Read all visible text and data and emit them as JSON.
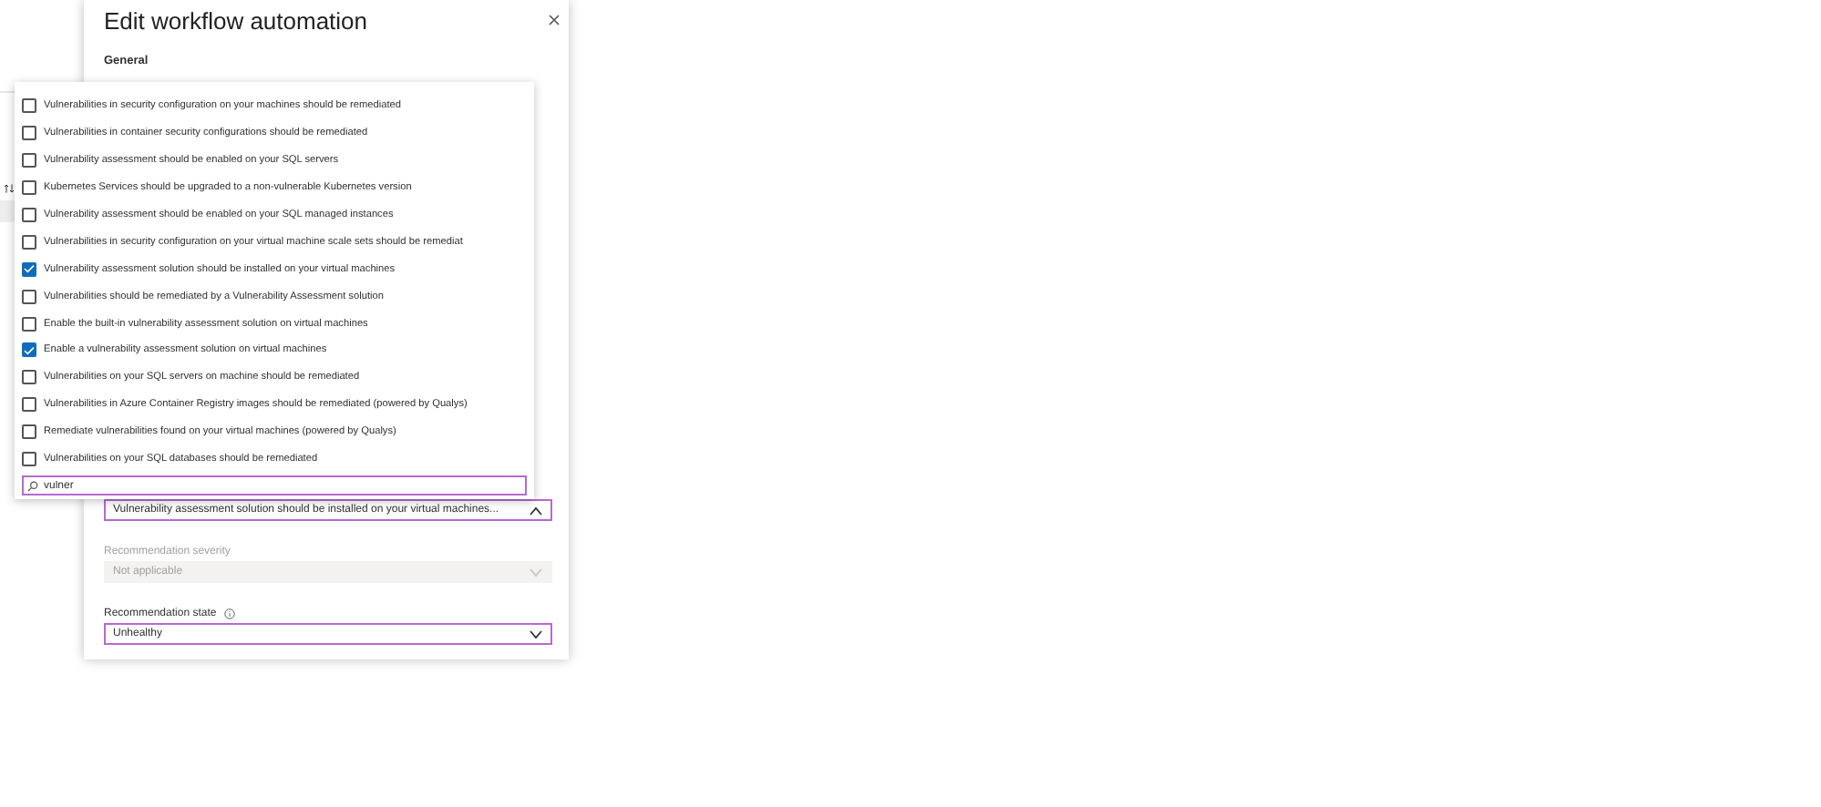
{
  "panel": {
    "title": "Edit workflow automation",
    "section": "General"
  },
  "recommendation_dropdown": {
    "options": [
      {
        "label": "Vulnerabilities in security configuration on your machines should be remediated",
        "checked": false
      },
      {
        "label": "Vulnerabilities in container security configurations should be remediated",
        "checked": false
      },
      {
        "label": "Vulnerability assessment should be enabled on your SQL servers",
        "checked": false
      },
      {
        "label": "Kubernetes Services should be upgraded to a non-vulnerable Kubernetes version",
        "checked": false
      },
      {
        "label": "Vulnerability assessment should be enabled on your SQL managed instances",
        "checked": false
      },
      {
        "label": "Vulnerabilities in security configuration on your virtual machine scale sets should be remediat",
        "checked": false
      },
      {
        "label": "Vulnerability assessment solution should be installed on your virtual machines",
        "checked": true
      },
      {
        "label": "Vulnerabilities should be remediated by a Vulnerability Assessment solution",
        "checked": false
      },
      {
        "label": "Enable the built-in vulnerability assessment solution on virtual machines",
        "checked": false
      },
      {
        "label": "Enable a vulnerability assessment solution on virtual machines",
        "checked": true
      },
      {
        "label": "Vulnerabilities on your SQL servers on machine should be remediated",
        "checked": false
      },
      {
        "label": "Vulnerabilities in Azure Container Registry images should be remediated (powered by Qualys)",
        "checked": false
      },
      {
        "label": "Remediate vulnerabilities found on your virtual machines (powered by Qualys)",
        "checked": false
      },
      {
        "label": "Vulnerabilities on your SQL databases should be remediated",
        "checked": false
      }
    ],
    "search": "vulner",
    "value": "Vulnerability assessment solution should be installed on your virtual machines...",
    "expanded": true
  },
  "fields": [
    {
      "label": "Recommendation severity",
      "value": "Not applicable",
      "disabled": true,
      "info": false
    },
    {
      "label": "Recommendation state",
      "value": "Unhealthy",
      "disabled": false,
      "info": true
    }
  ]
}
